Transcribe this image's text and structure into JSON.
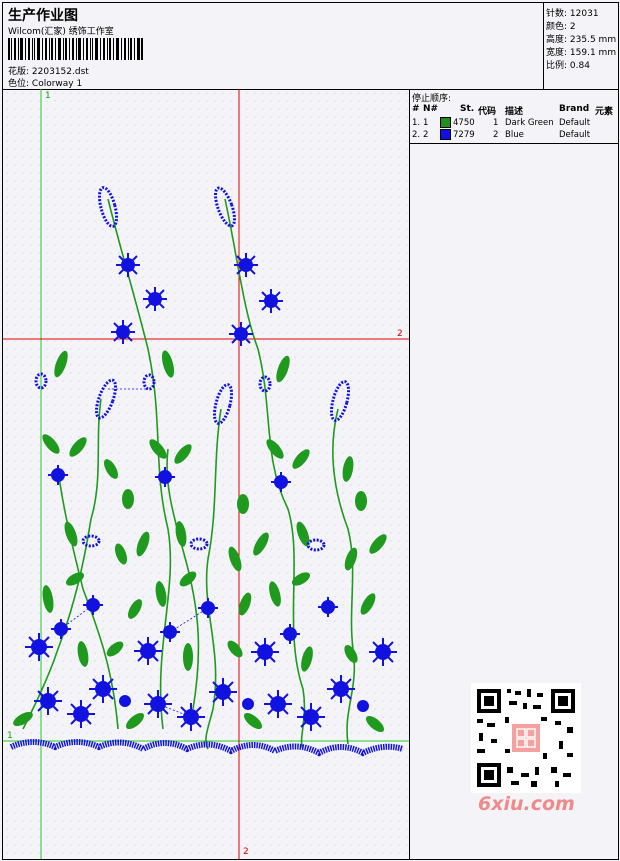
{
  "header": {
    "title": "生产作业图",
    "company": "Wilcom(汇家) 绣饰工作室",
    "design_file_label": "花版:",
    "design_file": "2203152.dst",
    "colorway_label": "色位:",
    "colorway": "Colorway 1"
  },
  "spec": {
    "stitches_label": "针数:",
    "stitches": "12031",
    "colors_label": "颜色:",
    "colors": "2",
    "height_label": "高度:",
    "height": "235.5 mm",
    "width_label": "宽度:",
    "width": "159.1 mm",
    "scale_label": "比例:",
    "scale": "0.84"
  },
  "stop_sequence": {
    "title": "停止顺序:",
    "columns": [
      "#",
      "N#",
      "St.",
      "代码",
      "描述",
      "Brand",
      "元素"
    ],
    "rows": [
      {
        "index": "1.",
        "needle": "1",
        "code": "4750",
        "num": "1",
        "desc": "Dark Green",
        "brand": "Default",
        "color": "#1f8f1f"
      },
      {
        "index": "2.",
        "needle": "2",
        "code": "7279",
        "num": "2",
        "desc": "Blue",
        "brand": "Default",
        "color": "#1010e0"
      }
    ]
  },
  "guides": {
    "v_green_top": "1",
    "h_red_right": "2",
    "h_green_left": "1",
    "v_red_bottom": "2"
  },
  "watermark": "6xiu.com",
  "colors": {
    "thread_green": "#1f9a1f",
    "thread_blue": "#1212e0",
    "guide_red": "#e00000",
    "guide_green": "#22cc22"
  }
}
